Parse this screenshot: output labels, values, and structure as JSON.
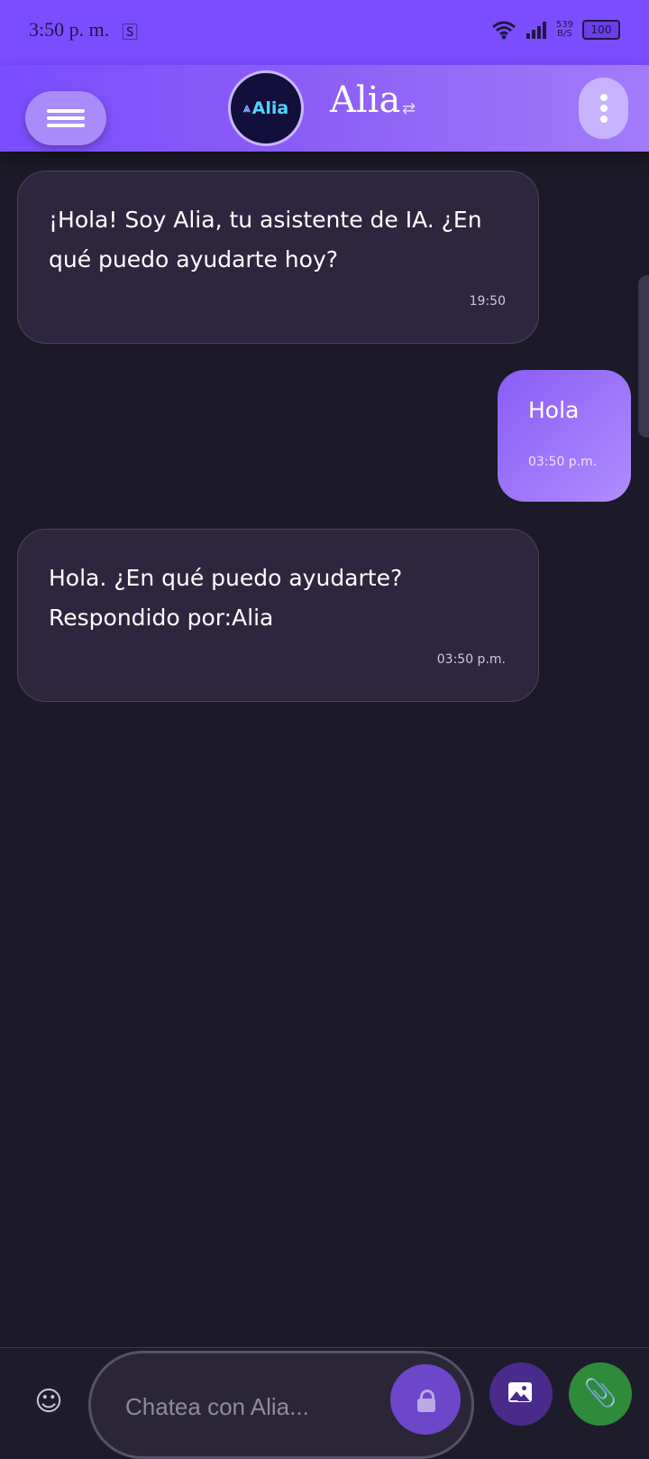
{
  "status_bar": {
    "time": "3:50 p. m.",
    "sim_icon": "sim-icon",
    "net_speed_value": "539",
    "net_speed_unit": "B/S",
    "battery": "100"
  },
  "header": {
    "menu_icon": "hamburger-menu-icon",
    "logo_text": "Alia",
    "title": "Alia",
    "swap_icon": "⇄",
    "more_icon": "more-vertical-icon"
  },
  "messages": [
    {
      "sender": "bot",
      "text": "¡Hola! Soy Alia, tu asistente de IA. ¿En qué puedo ayudarte hoy?",
      "time": "19:50"
    },
    {
      "sender": "user",
      "text": "Hola",
      "time": "03:50 p.m."
    },
    {
      "sender": "bot",
      "text": "Hola. ¿En qué puedo ayudarte? Respondido por:Alia",
      "time": "03:50 p.m."
    }
  ],
  "composer": {
    "placeholder": "Chatea con Alia...",
    "emoji_icon": "emoji-icon",
    "lock_icon": "lock-icon",
    "image_icon": "image-icon",
    "attach_icon": "paperclip-icon"
  },
  "colors": {
    "accent": "#7c4dff",
    "background": "#1c1928",
    "bot_bubble": "#2e263f",
    "user_bubble": "#9b6cfb",
    "attach_button": "#2e8b3a"
  }
}
